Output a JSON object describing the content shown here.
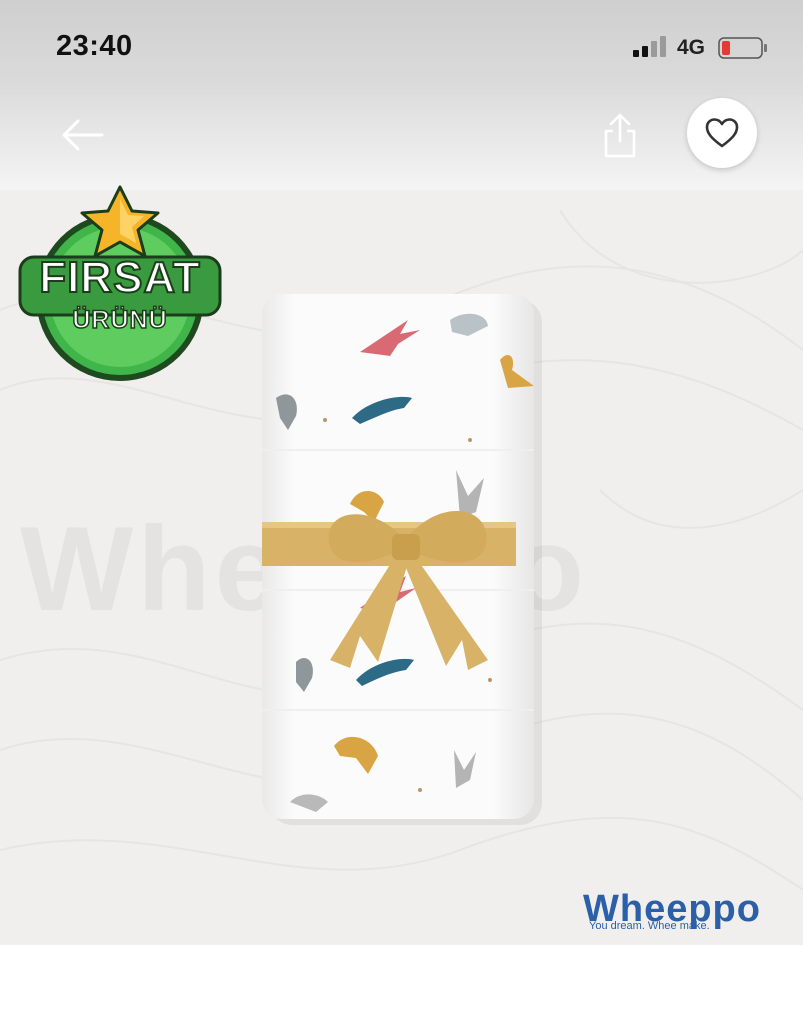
{
  "status_bar": {
    "time": "23:40",
    "network": "4G",
    "battery_color": "#e53935"
  },
  "nav": {
    "back_icon": "arrow-left-icon",
    "share_icon": "share-icon",
    "favorite_icon": "heart-outline-icon"
  },
  "product": {
    "badge": {
      "line1": "FIRSAT",
      "line2": "ÜRÜNÜ",
      "star_icon": "star-icon",
      "colors": {
        "ring": "#3fb54a",
        "star": "#f6b528",
        "stroke": "#1b3d1b"
      }
    },
    "image_description_icon": "muslin-blanket-with-ribbon",
    "ribbon_color": "#d8b266",
    "brand": {
      "name": "Wheeppo",
      "tagline": "You dream. Whee make.",
      "color": "#2b5fa8"
    },
    "background_watermark": "Wheeppo"
  }
}
